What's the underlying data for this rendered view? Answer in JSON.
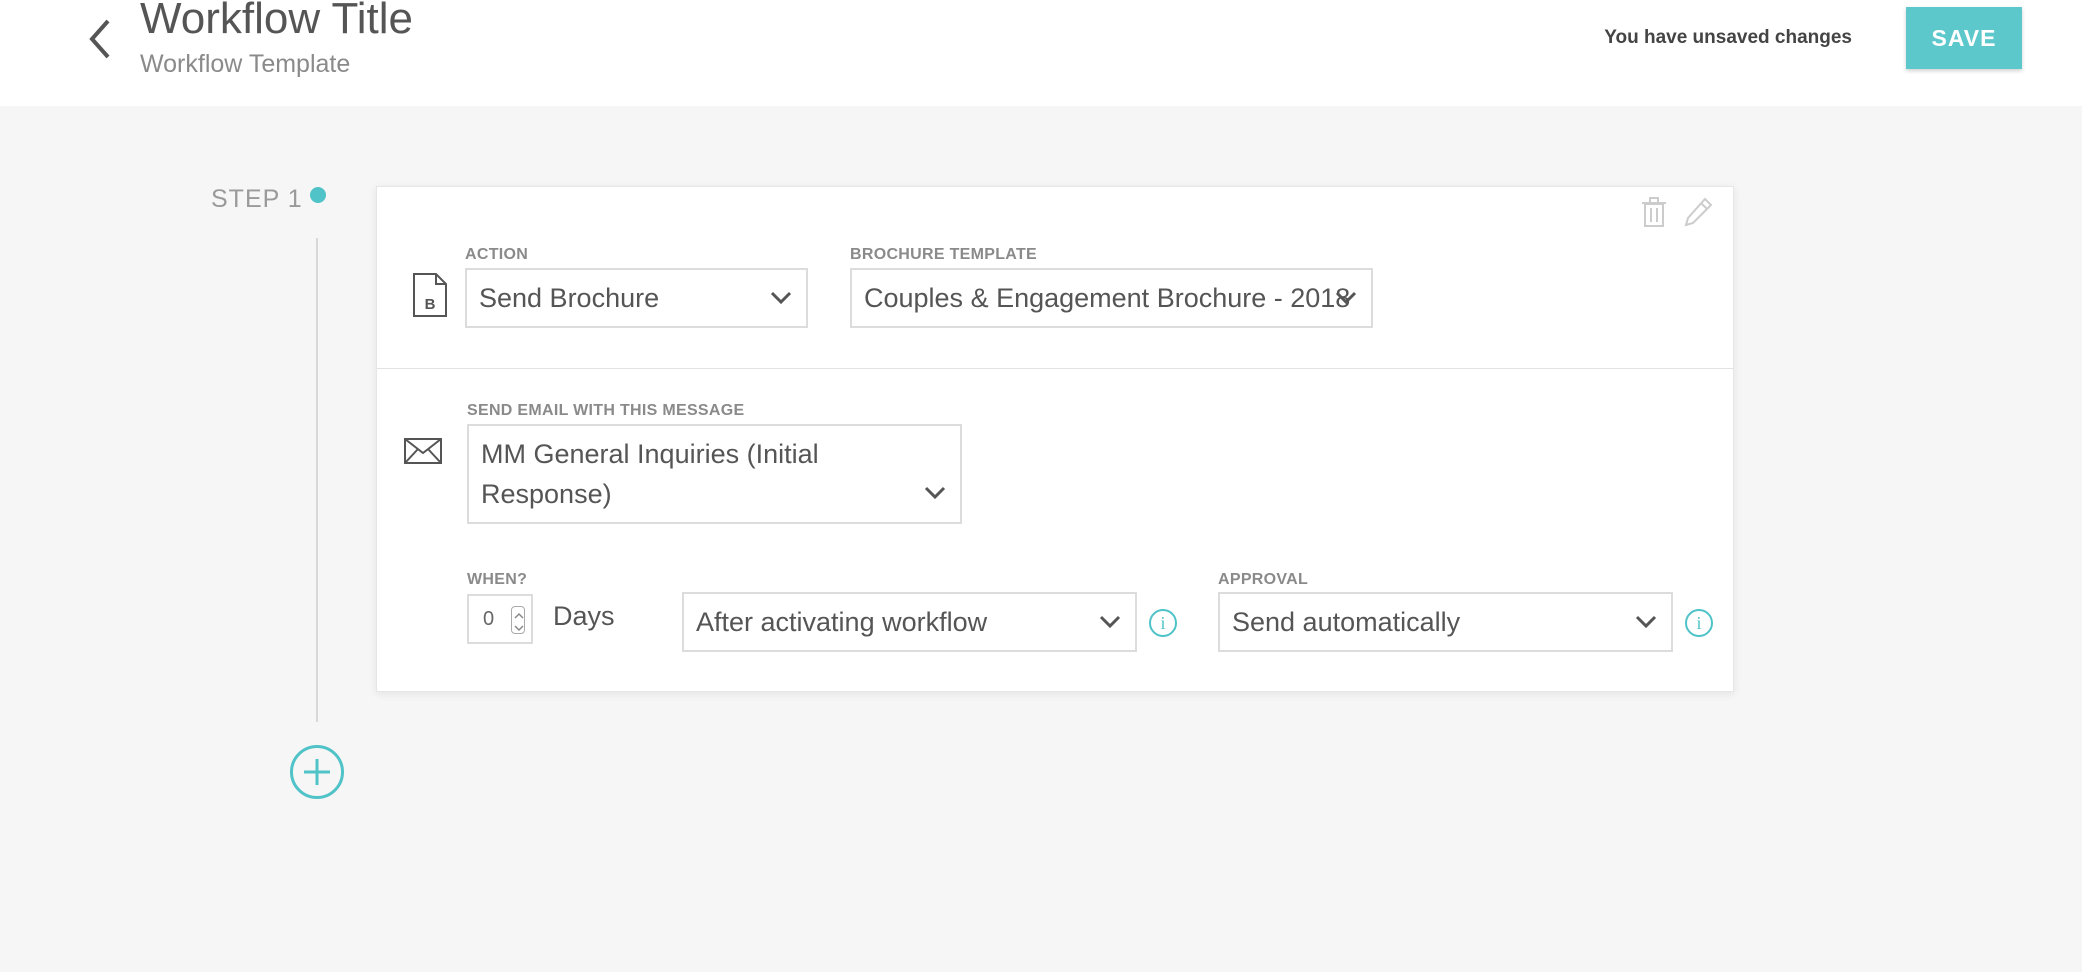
{
  "header": {
    "title": "Workflow Title",
    "subtitle": "Workflow Template",
    "unsaved_text": "You have unsaved changes",
    "save_label": "SAVE"
  },
  "step": {
    "label": "STEP 1"
  },
  "card": {
    "action": {
      "label": "ACTION",
      "icon_letter": "B",
      "value": "Send Brochure"
    },
    "brochure": {
      "label": "BROCHURE TEMPLATE",
      "value": "Couples & Engagement Brochure - 2018"
    },
    "email": {
      "label": "SEND EMAIL WITH THIS MESSAGE",
      "value": "MM General Inquiries (Initial Response)"
    },
    "when": {
      "label": "WHEN?",
      "days_value": "0",
      "days_unit": "Days",
      "trigger": "After activating workflow"
    },
    "approval": {
      "label": "APPROVAL",
      "value": "Send automatically"
    },
    "info_glyph": "i"
  },
  "colors": {
    "accent": "#5cc8cb",
    "background": "#f6f6f6"
  }
}
